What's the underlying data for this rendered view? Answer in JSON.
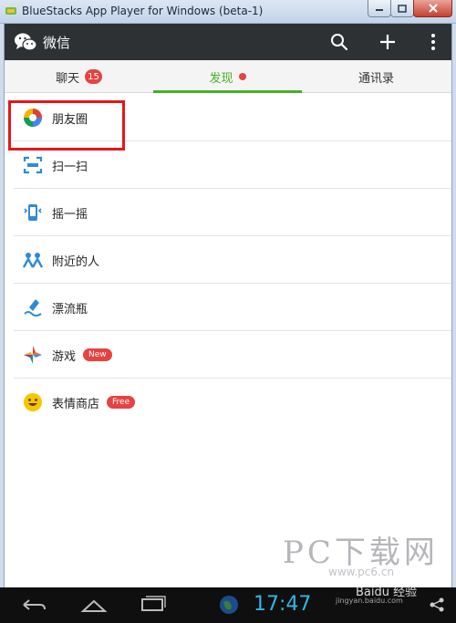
{
  "window": {
    "title": "BlueStacks App Player for Windows (beta-1)",
    "buttons": [
      "minimize",
      "maximize",
      "close"
    ]
  },
  "header": {
    "title": "微信",
    "icons": [
      "wechat-logo-icon",
      "search-icon",
      "plus-icon",
      "more-icon"
    ]
  },
  "tabs": [
    {
      "label": "聊天",
      "badge": "15",
      "active": false
    },
    {
      "label": "发现",
      "dot": true,
      "active": true
    },
    {
      "label": "通讯录",
      "active": false
    }
  ],
  "discover_items": [
    {
      "label": "朋友圈",
      "icon": "moments-icon"
    },
    {
      "label": "扫一扫",
      "icon": "scan-icon"
    },
    {
      "label": "摇一摇",
      "icon": "shake-icon"
    },
    {
      "label": "附近的人",
      "icon": "people-nearby-icon"
    },
    {
      "label": "漂流瓶",
      "icon": "drift-bottle-icon"
    },
    {
      "label": "游戏",
      "icon": "games-icon",
      "tag": "New"
    },
    {
      "label": "表情商店",
      "icon": "sticker-store-icon",
      "tag": "Free"
    }
  ],
  "navbar": {
    "clock": "17:47",
    "icons": [
      "back-icon",
      "home-icon",
      "recent-apps-icon",
      "globe-icon",
      "share-icon"
    ]
  },
  "watermark": {
    "brand": "PC下载网",
    "url": "www.pc6.cn",
    "baidu": "Baidu 经验",
    "baidu_url": "jingyan.baidu.com"
  },
  "colors": {
    "accent_green": "#46b02a",
    "badge_red": "#e64340",
    "header_dark": "#2e3134",
    "highlight_red": "#e5161b",
    "clock_blue": "#33b5e5"
  }
}
